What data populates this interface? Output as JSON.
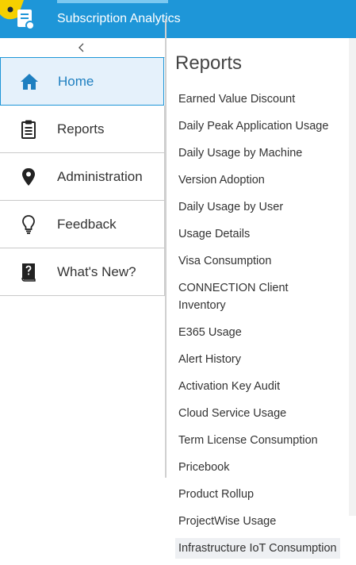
{
  "app": {
    "title": "Subscription Analytics",
    "brand_color": "#1e96d8",
    "accent_color": "#f5d000",
    "logo_icon": "subscription-report-icon"
  },
  "sidebar": {
    "collapse_icon": "chevron-left-icon",
    "items": [
      {
        "label": "Home",
        "icon": "home-icon",
        "active": true
      },
      {
        "label": "Reports",
        "icon": "clipboard-icon",
        "active": false
      },
      {
        "label": "Administration",
        "icon": "location-pin-icon",
        "active": false
      },
      {
        "label": "Feedback",
        "icon": "lightbulb-icon",
        "active": false
      },
      {
        "label": "What's New?",
        "icon": "question-book-icon",
        "active": false
      }
    ]
  },
  "main": {
    "title": "Reports",
    "reports": [
      "Earned Value Discount",
      "Daily Peak Application Usage",
      "Daily Usage by Machine",
      "Version Adoption",
      "Daily Usage by User",
      "Usage Details",
      "Visa Consumption",
      "CONNECTION Client Inventory",
      "E365 Usage",
      "Alert History",
      "Activation Key Audit",
      "Cloud Service Usage",
      "Term License Consumption",
      "Pricebook",
      "Product Rollup",
      "ProjectWise Usage",
      "Infrastructure IoT Consumption"
    ],
    "highlighted_report": "Infrastructure IoT Consumption"
  }
}
